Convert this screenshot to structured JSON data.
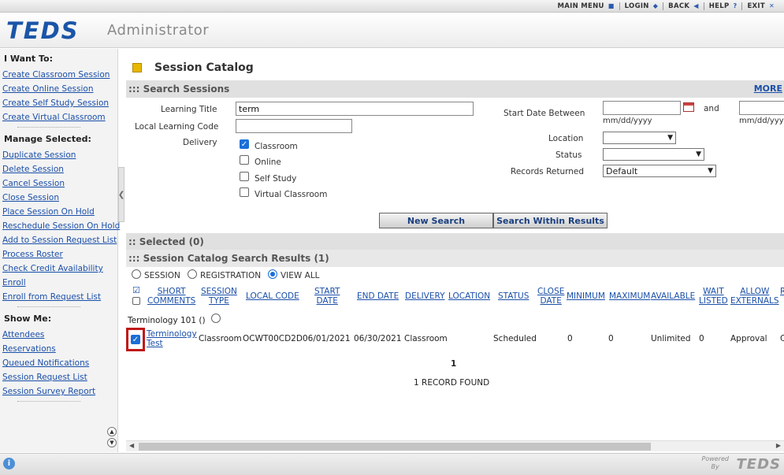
{
  "topnav": {
    "main_menu": "MAIN MENU",
    "login": "LOGIN",
    "back": "BACK",
    "help": "HELP",
    "exit": "EXIT"
  },
  "header": {
    "logo": "TEDS",
    "subtitle": "Administrator"
  },
  "sidebar": {
    "want_title": "I Want To:",
    "want_items": [
      "Create Classroom Session",
      "Create Online Session",
      "Create Self Study Session",
      "Create Virtual Classroom"
    ],
    "manage_title": "Manage Selected:",
    "manage_items": [
      "Duplicate Session",
      "Delete Session",
      "Cancel Session",
      "Close Session",
      "Place Session On Hold",
      "Reschedule Session On Hold",
      "Add to Session Request List",
      "Process Roster",
      "Check Credit Availability",
      "Enroll",
      "Enroll from Request List"
    ],
    "show_title": "Show Me:",
    "show_items": [
      "Attendees",
      "Reservations",
      "Queued Notifications",
      "Session Request List",
      "Session Survey Report"
    ]
  },
  "page_title": "Session Catalog",
  "search": {
    "band": "::: Search Sessions",
    "more": "MORE",
    "learning_title_label": "Learning Title",
    "learning_title_value": "term",
    "local_code_label": "Local Learning Code",
    "local_code_value": "",
    "delivery_label": "Delivery",
    "delivery_options": [
      "Classroom",
      "Online",
      "Self Study",
      "Virtual Classroom"
    ],
    "start_date_label": "Start Date Between",
    "and_label": "and",
    "date_format": "mm/dd/yyyy",
    "location_label": "Location",
    "status_label": "Status",
    "records_label": "Records Returned",
    "records_value": "Default",
    "new_search": "New Search",
    "search_within": "Search Within Results"
  },
  "selected_band": ":: Selected (0)",
  "results": {
    "band": "::: Session Catalog Search Results (1)",
    "view_options": [
      "SESSION",
      "REGISTRATION",
      "VIEW ALL"
    ],
    "columns": {
      "short_comments": [
        "SHORT",
        "COMMENTS"
      ],
      "session_type": [
        "SESSION",
        "TYPE"
      ],
      "local_code": "LOCAL CODE",
      "start_date": [
        "START",
        "DATE"
      ],
      "end_date": "END DATE",
      "delivery": "DELIVERY",
      "location": "LOCATION",
      "status": "STATUS",
      "close_date": [
        "CLOSE",
        "DATE"
      ],
      "minimum": "MINIMUM",
      "maximum": "MAXIMUM",
      "available": "AVAILABLE",
      "wait_listed": [
        "WAIT",
        "LISTED"
      ],
      "allow_externals": [
        "ALLOW",
        "EXTERNALS"
      ],
      "trailing": "R"
    },
    "group_label": "Terminology 101 ()",
    "row": {
      "name_line1": "Terminology",
      "name_line2": "Test",
      "session_type": "Classroom",
      "local_code": "OCWT00CD2D",
      "start_date": "06/01/2021",
      "end_date": "06/30/2021",
      "delivery": "Classroom",
      "status": "Scheduled",
      "minimum": "0",
      "maximum": "0",
      "available": "Unlimited",
      "wait_listed": "0",
      "allow_externals": "Approval",
      "trailing": "C"
    },
    "page": "1",
    "record_count": "1  RECORD FOUND"
  },
  "footer": {
    "powered": "Powered",
    "by": "By",
    "logo": "TEDS"
  }
}
